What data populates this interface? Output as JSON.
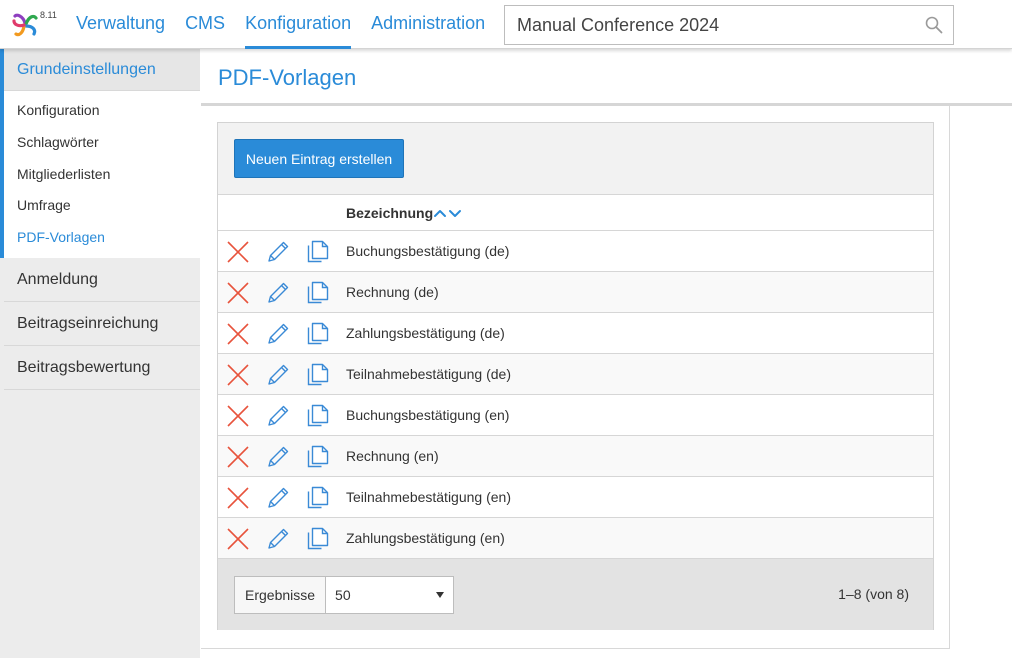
{
  "app": {
    "version": "8.11",
    "logo_icon": "colorful-asterisk-logo"
  },
  "nav": {
    "items": [
      {
        "label": "Verwaltung",
        "active": false
      },
      {
        "label": "CMS",
        "active": false
      },
      {
        "label": "Konfiguration",
        "active": true
      },
      {
        "label": "Administration",
        "active": false
      }
    ]
  },
  "search": {
    "value": "Manual Conference 2024",
    "icon": "search-icon"
  },
  "sidebar": {
    "active_group": {
      "label": "Grundeinstellungen",
      "items": [
        {
          "label": "Konfiguration",
          "active": false
        },
        {
          "label": "Schlagwörter",
          "active": false
        },
        {
          "label": "Mitgliederlisten",
          "active": false
        },
        {
          "label": "Umfrage",
          "active": false
        },
        {
          "label": "PDF-Vorlagen",
          "active": true
        }
      ]
    },
    "groups": [
      {
        "label": "Anmeldung"
      },
      {
        "label": "Beitragseinreichung"
      },
      {
        "label": "Beitragsbewertung"
      }
    ]
  },
  "main": {
    "title": "PDF-Vorlagen",
    "new_button_label": "Neuen Eintrag erstellen",
    "table": {
      "column_header": "Bezeichnung",
      "rows": [
        {
          "label": "Buchungsbestätigung (de)"
        },
        {
          "label": "Rechnung (de)"
        },
        {
          "label": "Zahlungsbestätigung (de)"
        },
        {
          "label": "Teilnahmebestätigung (de)"
        },
        {
          "label": "Buchungsbestätigung (en)"
        },
        {
          "label": "Rechnung (en)"
        },
        {
          "label": "Teilnahmebestätigung (en)"
        },
        {
          "label": "Zahlungsbestätigung (en)"
        }
      ]
    },
    "pager": {
      "results_label": "Ergebnisse",
      "page_size": "50",
      "range_text": "1–8 (von 8)"
    }
  },
  "colors": {
    "accent": "#2a8bd8",
    "delete": "#e8533c",
    "icon_blue": "#3a8ad6"
  }
}
